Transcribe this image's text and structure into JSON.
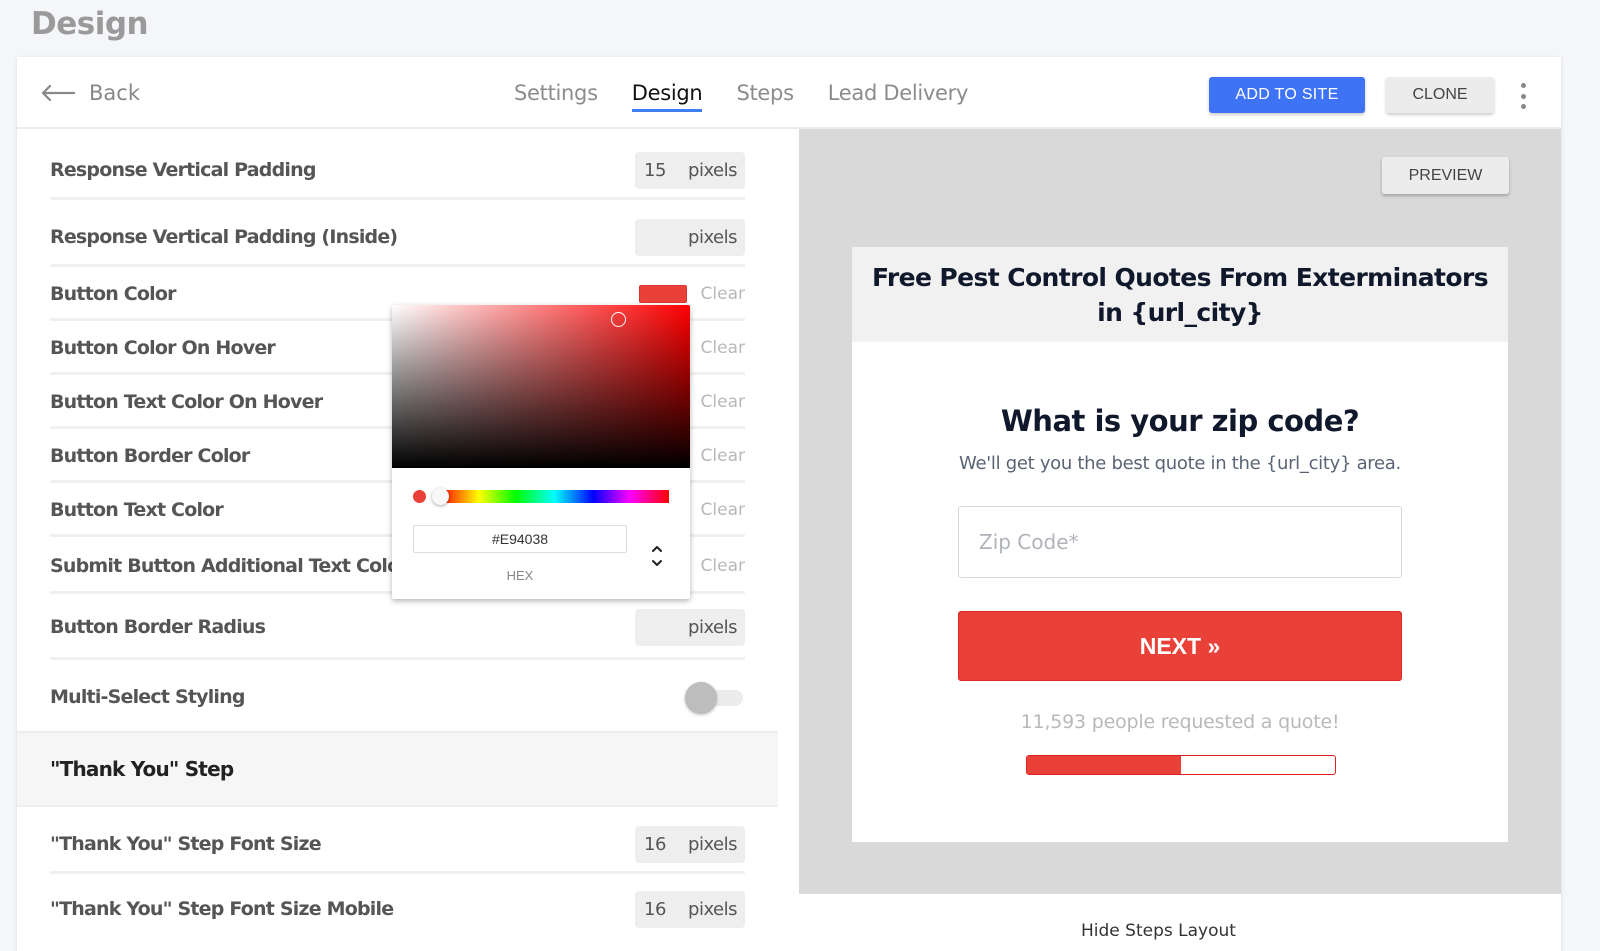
{
  "page": {
    "title": "Design"
  },
  "topbar": {
    "back_label": "Back",
    "tabs": [
      {
        "label": "Settings",
        "active": false
      },
      {
        "label": "Design",
        "active": true
      },
      {
        "label": "Steps",
        "active": false
      },
      {
        "label": "Lead Delivery",
        "active": false
      }
    ],
    "add_to_site_label": "ADD TO SITE",
    "clone_label": "CLONE",
    "more_icon": "kebab-menu-icon"
  },
  "settings": {
    "rows": [
      {
        "label": "Response Vertical Padding",
        "type": "pixels",
        "value": "15",
        "unit": "pixels"
      },
      {
        "label": "Response Vertical Padding (Inside)",
        "type": "pixels",
        "value": "",
        "unit": "pixels"
      },
      {
        "label": "Button Color",
        "type": "color",
        "value": "#E94038",
        "clear": "Clear"
      },
      {
        "label": "Button Color On Hover",
        "type": "color",
        "value": "",
        "clear": "Clear"
      },
      {
        "label": "Button Text Color On Hover",
        "type": "color",
        "value": "",
        "clear": "Clear"
      },
      {
        "label": "Button Border Color",
        "type": "color",
        "value": "",
        "clear": "Clear"
      },
      {
        "label": "Button Text Color",
        "type": "color",
        "value": "",
        "clear": "Clear"
      },
      {
        "label": "Submit Button Additional Text Color",
        "type": "color",
        "value": "",
        "clear": "Clear"
      },
      {
        "label": "Button Border Radius",
        "type": "pixels",
        "value": "",
        "unit": "pixels"
      },
      {
        "label": "Multi-Select Styling",
        "type": "toggle",
        "value": false
      }
    ],
    "section_title": "\"Thank You\" Step",
    "section_rows": [
      {
        "label": "\"Thank You\" Step Font Size",
        "type": "pixels",
        "value": "16",
        "unit": "pixels"
      },
      {
        "label": "\"Thank You\" Step Font Size Mobile",
        "type": "pixels",
        "value": "16",
        "unit": "pixels"
      }
    ]
  },
  "color_picker": {
    "hex_value": "#E94038",
    "mode_label": "HEX",
    "current_color": "#E94038"
  },
  "preview": {
    "preview_label": "PREVIEW",
    "headline": "Free Pest Control Quotes From Exterminators in {url_city}",
    "question": "What is your zip code?",
    "subtitle": "We'll get you the best quote in the {url_city} area.",
    "zip_placeholder": "Zip Code*",
    "zip_value": "",
    "next_label": "NEXT »",
    "count_text": "11,593 people requested a quote!",
    "progress_percent": 50,
    "brand_color": "#E94038"
  },
  "footer": {
    "hide_steps_label": "Hide Steps Layout"
  }
}
